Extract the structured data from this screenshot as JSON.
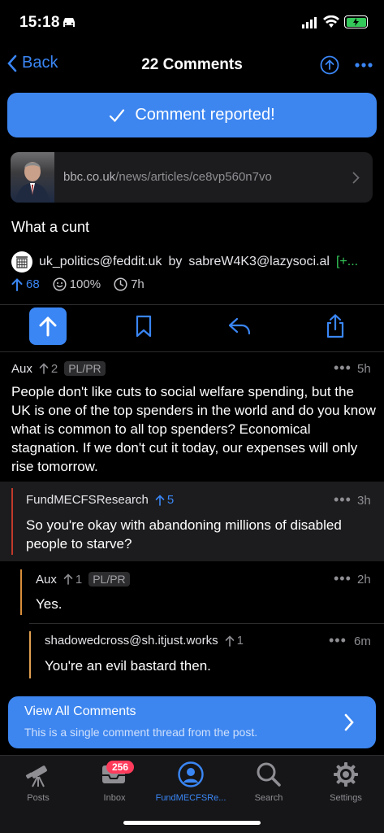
{
  "status": {
    "time": "15:18"
  },
  "nav": {
    "back_label": "Back",
    "title": "22 Comments"
  },
  "toast": {
    "text": "Comment reported!"
  },
  "post": {
    "link_domain": "bbc.co.uk",
    "link_path": "/news/articles/ce8vp560n7vo",
    "body": "What a cunt",
    "community": "uk_politics@feddit.uk",
    "by": "by",
    "author": "sabreW4K3@lazysoci.al",
    "author_flair": "[+...",
    "score": "68",
    "upvote_ratio": "100%",
    "age": "7h"
  },
  "comments": [
    {
      "author": "Aux",
      "score": "2",
      "tag": "PL/PR",
      "time": "5h",
      "text": "People don't like cuts to social welfare spending, but the UK is one of the top spenders in the world and do you know what is common to all top spenders? Economical stagnation. If we don't cut it today, our expenses will only rise tomorrow.",
      "dots": "•••"
    },
    {
      "author": "FundMECFSResearch",
      "score": "5",
      "time": "3h",
      "text": "So you're okay with abandoning millions of disabled people to starve?",
      "dots": "•••",
      "bar_color": "#c0392b"
    },
    {
      "author": "Aux",
      "score": "1",
      "tag": "PL/PR",
      "time": "2h",
      "text": "Yes.",
      "dots": "•••",
      "bar_color": "#d98e3a"
    },
    {
      "author": "shadowedcross@sh.itjust.works",
      "score": "1",
      "time": "6m",
      "text": "You're an evil bastard then.",
      "dots": "•••",
      "bar_color": "#e0a050"
    }
  ],
  "view_all": {
    "title": "View All Comments",
    "subtitle": "This is a single comment thread from the post."
  },
  "tabs": [
    {
      "label": "Posts",
      "icon": "telescope-icon"
    },
    {
      "label": "Inbox",
      "icon": "inbox-icon",
      "badge": "256"
    },
    {
      "label": "FundMECFSRe...",
      "icon": "profile-icon"
    },
    {
      "label": "Search",
      "icon": "search-icon"
    },
    {
      "label": "Settings",
      "icon": "gear-icon"
    }
  ],
  "colors": {
    "accent": "#3a86f5",
    "background": "#000000",
    "upvote_active": "#3a86f5",
    "flair": "#34c759",
    "badge": "#ff3b5c"
  }
}
